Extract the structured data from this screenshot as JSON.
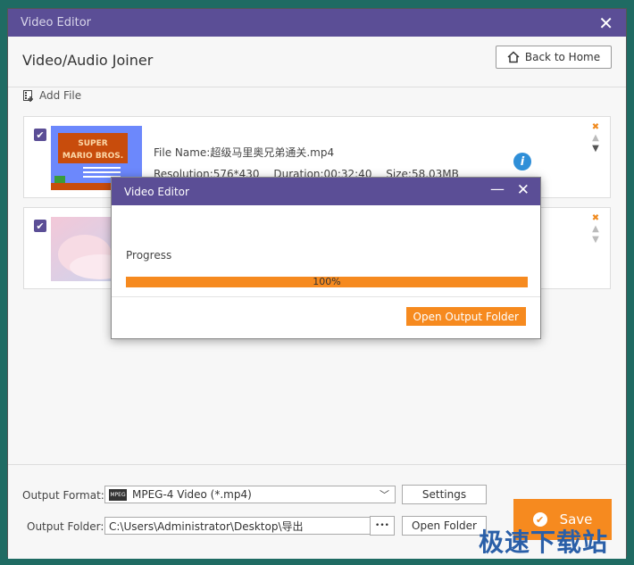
{
  "window": {
    "title": "Video Editor"
  },
  "header": {
    "title": "Video/Audio Joiner",
    "back_home": "Back to Home"
  },
  "toolbar": {
    "add_file": "Add File"
  },
  "items": [
    {
      "file_name": "File Name:超级马里奥兄弟通关.mp4",
      "resolution": "Resolution:576*430",
      "duration": "Duration:00:32:40",
      "size": "Size:58.03MB",
      "thumb_text1": "SUPER",
      "thumb_text2": "MARIO BROS."
    },
    {}
  ],
  "footer": {
    "output_format_label": "Output Format:",
    "output_format_value": "MPEG-4 Video (*.mp4)",
    "format_badge": "MPEG",
    "settings": "Settings",
    "output_folder_label": "Output Folder:",
    "output_folder_value": "C:\\Users\\Administrator\\Desktop\\导出",
    "browse": "•••",
    "open_folder": "Open Folder",
    "save": "Save"
  },
  "dialog": {
    "title": "Video Editor",
    "progress_label": "Progress",
    "progress_percent": 100,
    "progress_text": "100%",
    "open_output": "Open Output Folder"
  },
  "watermark": "极速下载站",
  "colors": {
    "accent": "#5b4e96",
    "orange": "#f68a1f"
  }
}
